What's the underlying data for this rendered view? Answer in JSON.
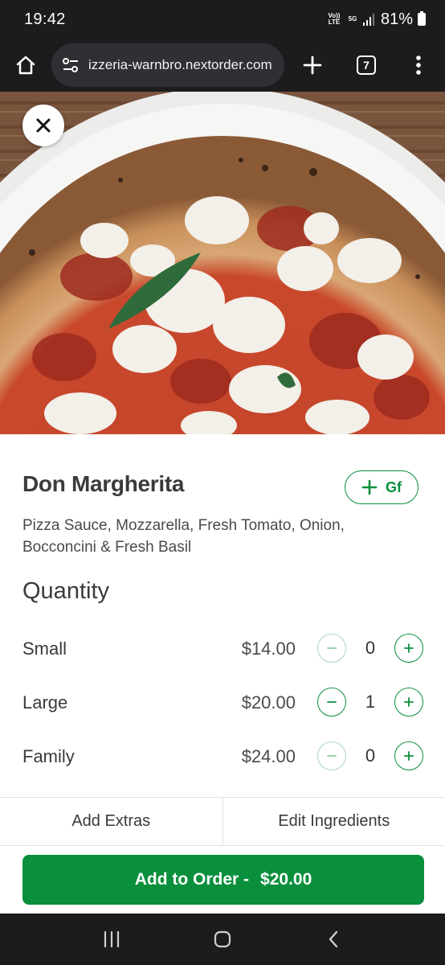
{
  "status_bar": {
    "time": "19:42",
    "network_top": "Vo)) LTE",
    "network_5g": "5G",
    "battery": "81%"
  },
  "browser": {
    "url": "izzeria-warnbro.nextorder.com",
    "tab_count": "7",
    "icons": [
      "home-icon",
      "site-settings-icon",
      "plus-icon",
      "tabs-icon",
      "more-vert-icon"
    ]
  },
  "hero": {
    "close_icon": "close-icon"
  },
  "product": {
    "title": "Don Margherita",
    "gf_label": "Gf",
    "description": "Pizza Sauce, Mozzarella, Fresh Tomato, Onion, Bocconcini & Fresh Basil"
  },
  "quantity": {
    "heading": "Quantity",
    "sizes": [
      {
        "name": "Small",
        "price": "$14.00",
        "qty": "0",
        "minus_enabled": false
      },
      {
        "name": "Large",
        "price": "$20.00",
        "qty": "1",
        "minus_enabled": true
      },
      {
        "name": "Family",
        "price": "$24.00",
        "qty": "0",
        "minus_enabled": false
      }
    ]
  },
  "actions": {
    "add_extras": "Add Extras",
    "edit_ingredients": "Edit Ingredients",
    "add_to_order": "Add to Order -",
    "order_total": "$20.00"
  },
  "colors": {
    "accent": "#0a8f3c",
    "bar_dark": "#1c1c1e"
  }
}
